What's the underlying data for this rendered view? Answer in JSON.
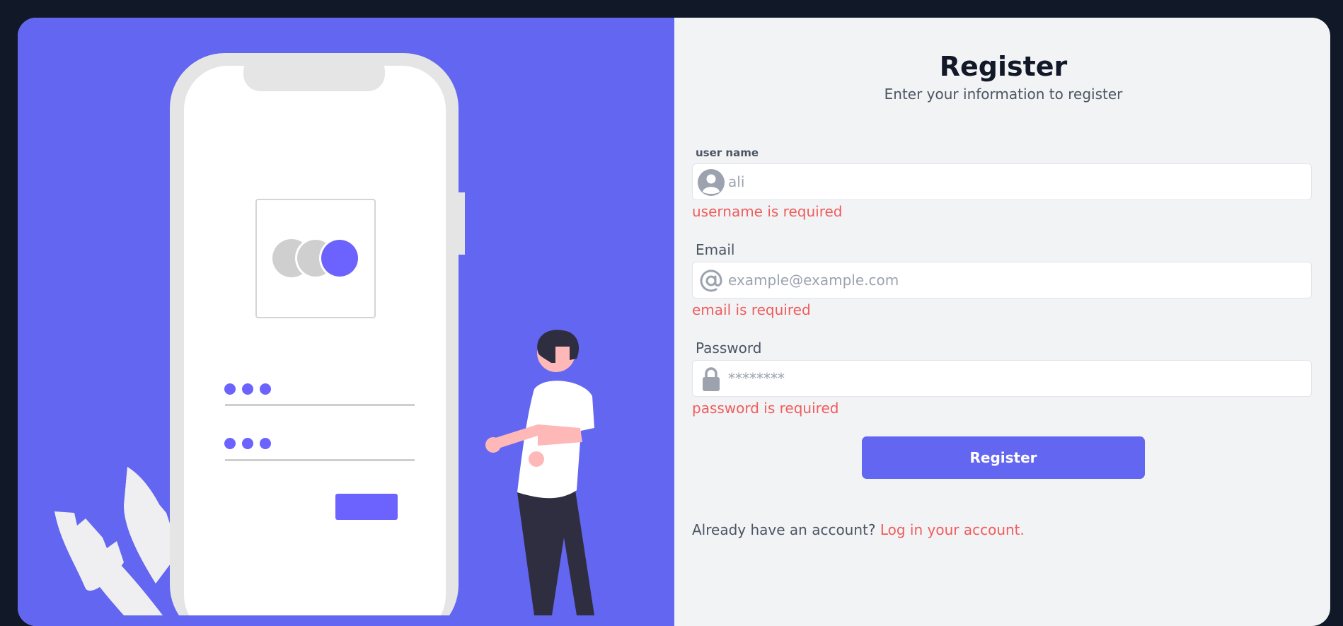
{
  "colors": {
    "accent": "#6366f1",
    "error": "#f05c5c",
    "background": "#111827",
    "panel": "#f2f3f5"
  },
  "form": {
    "title": "Register",
    "subtitle": "Enter your information to register",
    "username": {
      "label": "user name",
      "value": "",
      "placeholder": "ali",
      "icon": "user-icon",
      "error": "username is required"
    },
    "email": {
      "label": "Email",
      "value": "",
      "placeholder": "example@example.com",
      "icon": "at-icon",
      "error": "email is required"
    },
    "password": {
      "label": "Password",
      "value": "",
      "placeholder": "********",
      "icon": "lock-icon",
      "error": "password is required"
    },
    "submit_label": "Register",
    "footer_text": "Already have an account? ",
    "footer_link": "Log in your account."
  }
}
